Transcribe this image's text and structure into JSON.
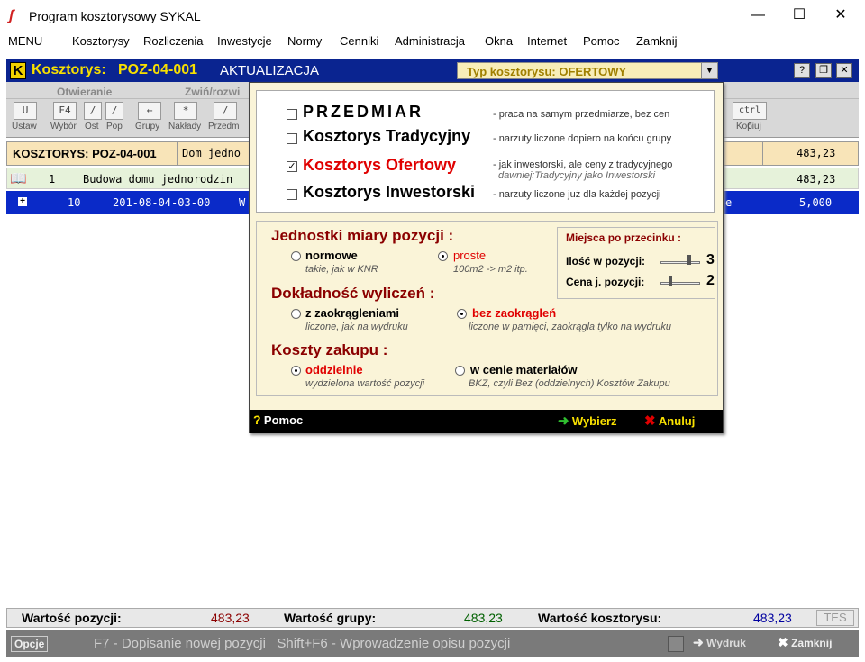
{
  "window": {
    "title": "Program kosztorysowy SYKAL"
  },
  "menu": [
    "MENU",
    "Kosztorysy",
    "Rozliczenia",
    "Inwestycje",
    "Normy",
    "Cenniki",
    "Administracja",
    "Okna",
    "Internet",
    "Pomoc",
    "Zamknij"
  ],
  "mdi": {
    "label": "Kosztorys:",
    "id": "POZ-04-001",
    "mode": "AKTUALIZACJA",
    "type_label": "Typ kosztorysu:  OFERTOWY",
    "buttons": [
      "?",
      "❐",
      "✕"
    ]
  },
  "toolbar": {
    "groups": [
      "Otwieranie",
      "Zwiń/rozwi"
    ],
    "buttons": [
      {
        "key": "U",
        "label": "Ustaw"
      },
      {
        "key": "F4",
        "label": "Wybór"
      },
      {
        "key": "/",
        "label": "Ost"
      },
      {
        "key": "/",
        "label": "Pop"
      },
      {
        "key": "←",
        "label": "Grupy"
      },
      {
        "key": "*",
        "label": "Nakłady"
      },
      {
        "key": "/",
        "label": "Przedm"
      },
      {
        "key": "ctrl C",
        "label": "Kopiuj"
      }
    ]
  },
  "rows": {
    "header": {
      "title": "KOSZTORYS: POZ-04-001",
      "desc": "Dom jedno",
      "value": "483,23"
    },
    "row1": {
      "num": "1",
      "desc": "Budowa domu jednorodzin",
      "value": "483,23"
    },
    "row2": {
      "num": "10",
      "code": "201-08-04-03-00",
      "desc": "W",
      "suffix": "e",
      "value": "5,000"
    }
  },
  "dialog": {
    "types": [
      {
        "name": "PRZEDMIAR",
        "desc": "- praca na samym przedmiarze, bez cen",
        "checked": false
      },
      {
        "name": "Kosztorys Tradycyjny",
        "desc": "- narzuty liczone dopiero na końcu grupy",
        "checked": false
      },
      {
        "name": "Kosztorys Ofertowy",
        "desc": "- jak inwestorski, ale ceny z tradycyjnego",
        "desc2": "dawniej:Tradycyjny jako Inwestorski",
        "checked": true
      },
      {
        "name": "Kosztorys Inwestorski",
        "desc": "- narzuty liczone już dla każdej pozycji",
        "checked": false
      }
    ],
    "units": {
      "title": "Jednostki miary pozycji :",
      "opt1": "normowe",
      "opt1_desc": "takie, jak w KNR",
      "opt2": "proste",
      "opt2_desc": "100m2 -> m2 itp.",
      "selected": "proste"
    },
    "precision": {
      "title": "Dokładność wyliczeń :",
      "opt1": "z zaokrągleniami",
      "opt1_desc": "liczone, jak na wydruku",
      "opt2": "bez zaokrągleń",
      "opt2_desc": "liczone w pamięci, zaokrągla tylko na wydruku",
      "selected": "bez zaokrągleń"
    },
    "purchase": {
      "title": "Koszty zakupu :",
      "opt1": "oddzielnie",
      "opt1_desc": "wydzielona wartość pozycji",
      "opt2": "w cenie materiałów",
      "opt2_desc": "BKZ, czyli Bez (oddzielnych) Kosztów Zakupu",
      "selected": "oddzielnie"
    },
    "decimals": {
      "title": "Miejsca po przecinku :",
      "qty_label": "Ilość w pozycji:",
      "qty_value": "3",
      "price_label": "Cena j. pozycji:",
      "price_value": "2"
    },
    "footer": {
      "help": "Pomoc",
      "ok": "Wybierz",
      "cancel": "Anuluj"
    }
  },
  "totals": {
    "pos_label": "Wartość pozycji:",
    "pos_value": "483,23",
    "grp_label": "Wartość grupy:",
    "grp_value": "483,23",
    "kos_label": "Wartość kosztorysu:",
    "kos_value": "483,23",
    "tes": "TES"
  },
  "status": {
    "options": "Opcje",
    "hint": "F7 - Dopisanie nowej pozycji   Shift+F6 - Wprowadzenie opisu pozycji",
    "print": "Wydruk",
    "close": "Zamknij"
  },
  "colors": {
    "mdi_header": "#0a2490",
    "row_selected": "#0a2ac8",
    "accent_red": "#e00000",
    "section_red": "#8b0000"
  }
}
